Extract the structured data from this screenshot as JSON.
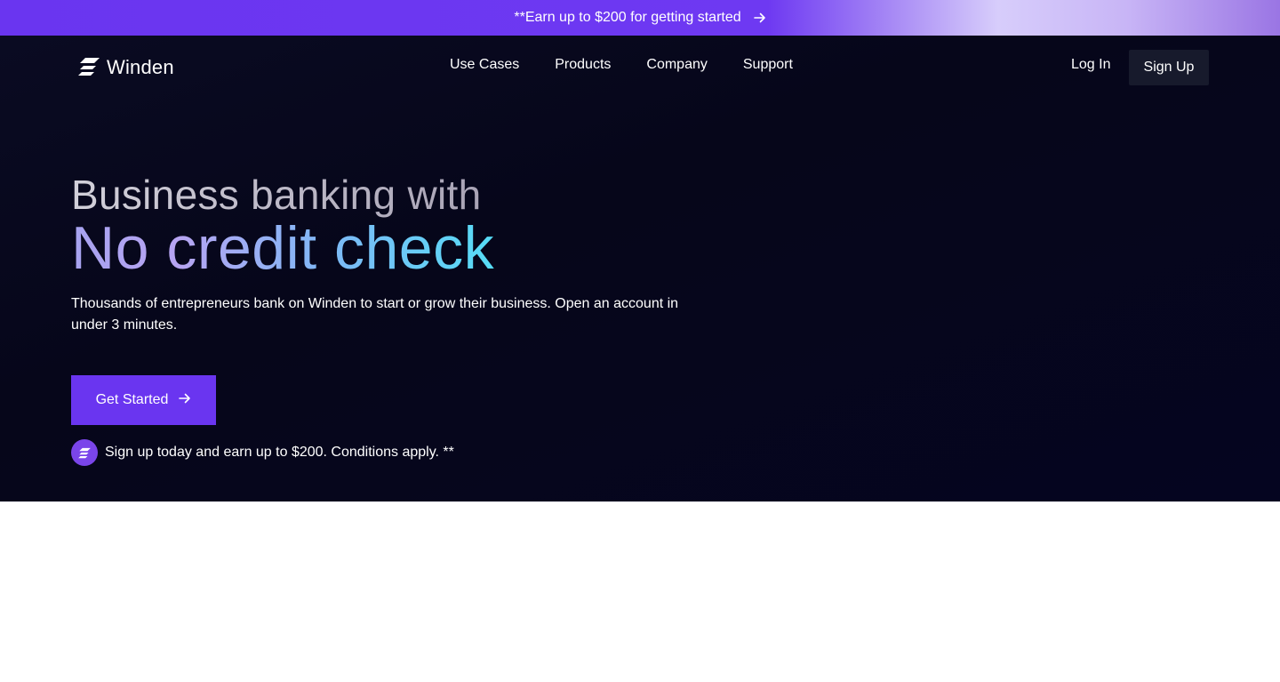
{
  "promo": {
    "text": "**Earn up to $200 for getting started",
    "icon": "arrow-right-icon"
  },
  "nav": {
    "logo_text": "Winden",
    "logo_icon": "winden-logo-icon",
    "links": [
      "Use Cases",
      "Products",
      "Company",
      "Support"
    ],
    "login_label": "Log In",
    "signup_label": "Sign Up"
  },
  "hero": {
    "headline_line1": "Business banking with",
    "headline_line2": "No credit check",
    "subtext": "Thousands of entrepreneurs bank on Winden to start or grow their business. Open an account in under 3 minutes.",
    "cta_label": "Get Started",
    "cta_icon": "arrow-right-icon",
    "note_text": "Sign up today and earn up to $200. Conditions apply. **",
    "note_icon": "winden-badge-icon"
  },
  "colors": {
    "accent": "#6a35f0",
    "hero_background": "#06061a",
    "signup_button": "#171a2c",
    "headline_gradient_start": "#a7a3f0",
    "headline_gradient_end": "#56dcf6"
  }
}
